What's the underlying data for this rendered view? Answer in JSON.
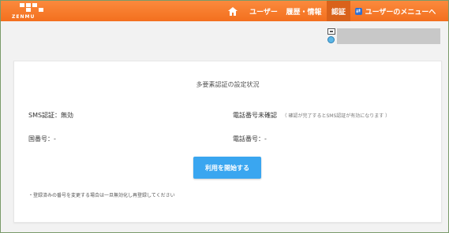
{
  "header": {
    "logo_text": "ZENMU",
    "nav": [
      {
        "label": "ユーザー"
      },
      {
        "label": "履歴・情報"
      },
      {
        "label": "認証"
      },
      {
        "label": "ユーザーのメニューへ"
      }
    ],
    "active_tab": "認証"
  },
  "card": {
    "title": "多要素認証の設定状況",
    "sms_status": "SMS認証：無効",
    "phone_unconfirmed": "電話番号未確認",
    "phone_note": "（ 確認が完了するとSMS認証が有効になります ）",
    "country_code": "国番号：-",
    "phone_number": "電話番号：-",
    "start_button": "利用を開始する",
    "footnote": "・登録済みの番号を変更する場合は一旦無効化し再登録してください"
  },
  "colors": {
    "header": "#f47a2a",
    "header_active": "#d9621b",
    "button": "#3aa6f0"
  }
}
